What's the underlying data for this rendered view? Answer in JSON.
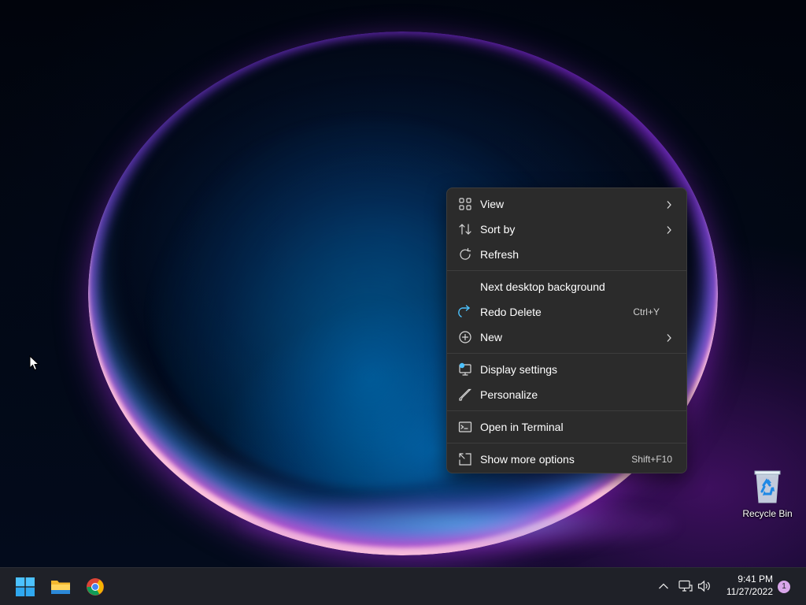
{
  "desktop": {
    "icons": [
      {
        "label": "Recycle Bin",
        "icon": "recycle-bin-icon"
      }
    ]
  },
  "context_menu": {
    "items": [
      {
        "label": "View",
        "icon": "view-grid-icon",
        "submenu": true
      },
      {
        "label": "Sort by",
        "icon": "sort-icon",
        "submenu": true
      },
      {
        "label": "Refresh",
        "icon": "refresh-icon"
      },
      {
        "label": "Next desktop background",
        "icon": ""
      },
      {
        "label": "Redo Delete",
        "icon": "redo-icon",
        "shortcut": "Ctrl+Y"
      },
      {
        "label": "New",
        "icon": "new-plus-icon",
        "submenu": true
      },
      {
        "label": "Display settings",
        "icon": "display-settings-icon"
      },
      {
        "label": "Personalize",
        "icon": "personalize-brush-icon"
      },
      {
        "label": "Open in Terminal",
        "icon": "terminal-icon"
      },
      {
        "label": "Show more options",
        "icon": "show-more-options-icon",
        "shortcut": "Shift+F10"
      }
    ]
  },
  "taskbar": {
    "apps": [
      {
        "name": "Start",
        "icon": "windows-start-icon"
      },
      {
        "name": "File Explorer",
        "icon": "file-explorer-icon"
      },
      {
        "name": "Google Chrome",
        "icon": "chrome-icon"
      }
    ],
    "tray": {
      "icons": [
        "show-hidden-icons-chevron",
        "network-icon",
        "volume-icon"
      ],
      "time": "9:41 PM",
      "date": "11/27/2022",
      "notification_count": "1"
    }
  },
  "colors": {
    "menu_bg": "#2b2b2b",
    "taskbar_bg": "#1f2128",
    "accent_blue": "#4cc2ff",
    "notification_badge": "#d9a6ea"
  }
}
